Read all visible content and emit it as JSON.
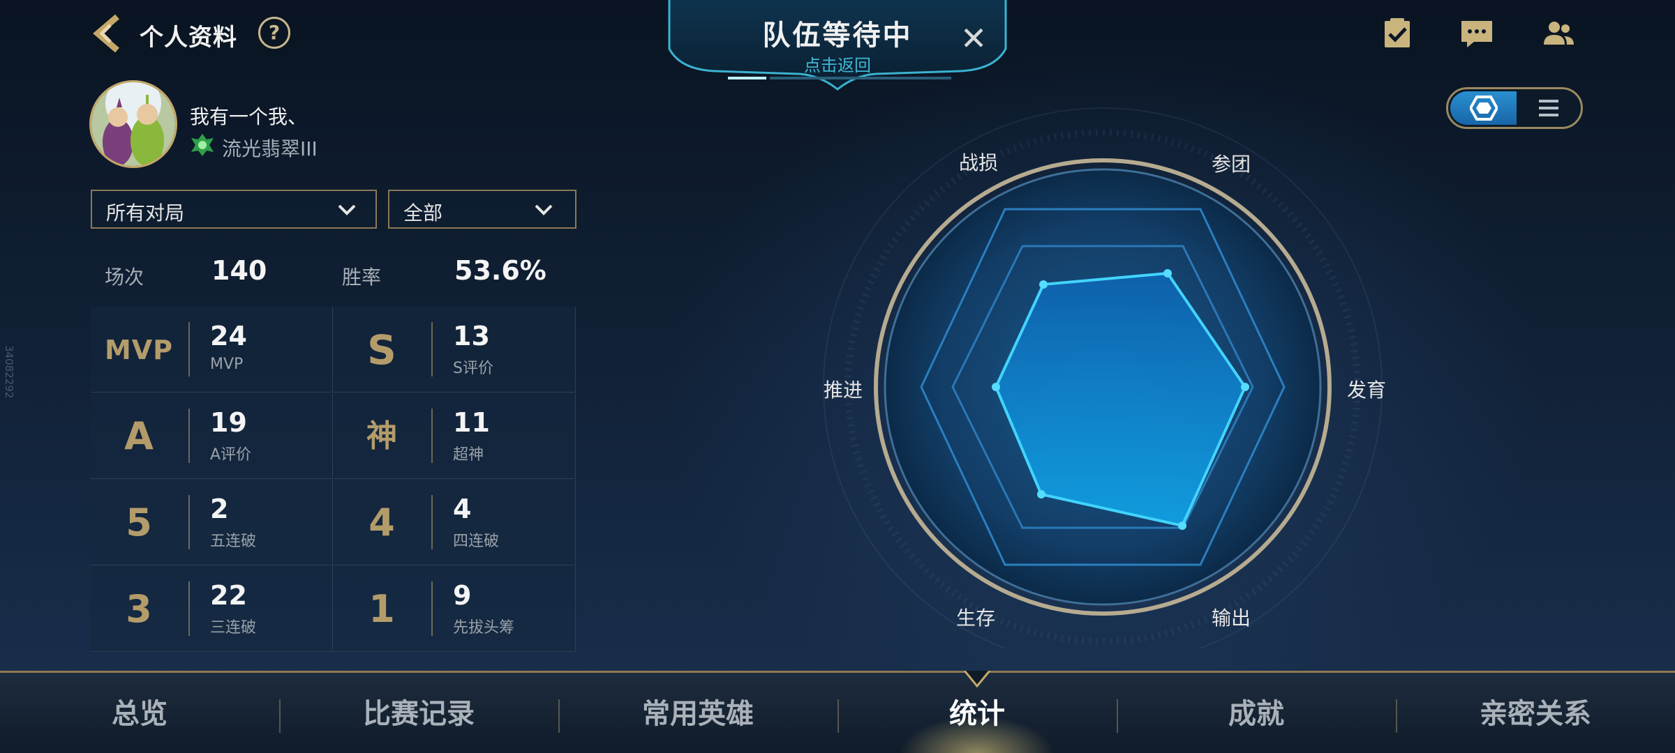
{
  "header": {
    "title": "个人资料",
    "help": "?"
  },
  "queue": {
    "title": "队伍等待中",
    "subtitle": "点击返回",
    "close": "✕"
  },
  "profile": {
    "username": "我有一个我、",
    "rank": "流光翡翠III"
  },
  "filters": {
    "mode": "所有对局",
    "scope": "全部"
  },
  "summary": {
    "matches_label": "场次",
    "matches_value": "140",
    "winrate_label": "胜率",
    "winrate_value": "53.6%"
  },
  "stats": [
    {
      "glyph": "MVP",
      "value": "24",
      "label": "MVP"
    },
    {
      "glyph": "S",
      "value": "13",
      "label": "S评价"
    },
    {
      "glyph": "A",
      "value": "19",
      "label": "A评价"
    },
    {
      "glyph": "神",
      "value": "11",
      "label": "超神"
    },
    {
      "glyph": "5",
      "value": "2",
      "label": "五连破"
    },
    {
      "glyph": "4",
      "value": "4",
      "label": "四连破"
    },
    {
      "glyph": "3",
      "value": "22",
      "label": "三连破"
    },
    {
      "glyph": "1",
      "value": "9",
      "label": "先拔头筹"
    }
  ],
  "side_watermark": "34082292",
  "radar": {
    "labels": {
      "top_left": "战损",
      "top_right": "参团",
      "left": "推进",
      "right": "发育",
      "bottom_left": "生存",
      "bottom_right": "输出"
    },
    "accent": "#3cc8ff"
  },
  "nav": {
    "items": [
      "总览",
      "比赛记录",
      "常用英雄",
      "统计",
      "成就",
      "亲密关系"
    ],
    "active": "统计"
  },
  "colors": {
    "gold": "#c5a868",
    "accent_blue": "#2a8fd0",
    "background": "#0b1626"
  }
}
